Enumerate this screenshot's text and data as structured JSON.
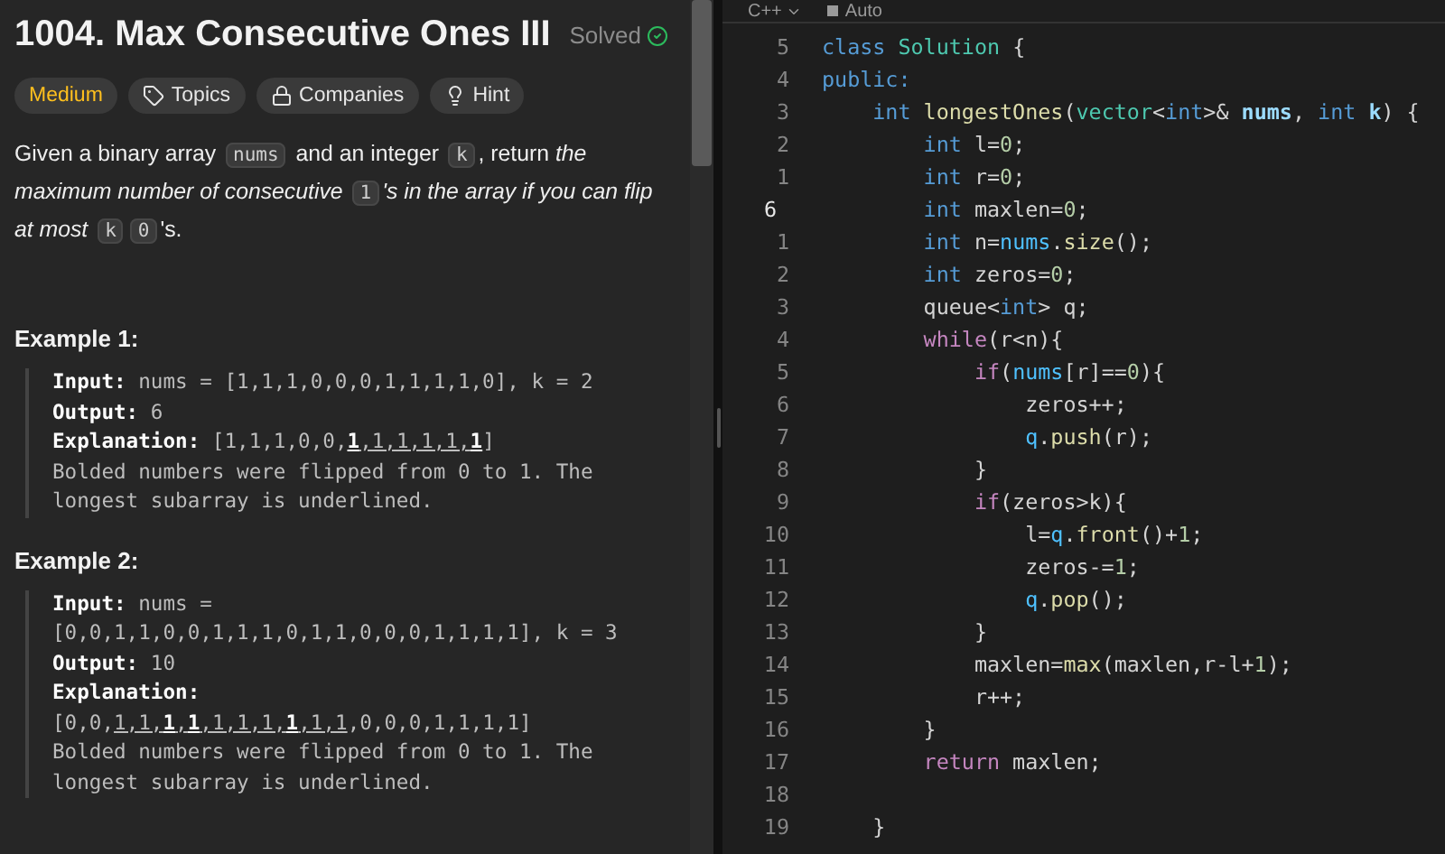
{
  "problem": {
    "title": "1004. Max Consecutive Ones III",
    "status": "Solved",
    "tags": [
      {
        "kind": "difficulty",
        "label": "Medium"
      },
      {
        "kind": "topics",
        "label": "Topics"
      },
      {
        "kind": "companies",
        "label": "Companies"
      },
      {
        "kind": "hint",
        "label": "Hint"
      }
    ],
    "description": [
      {
        "kind": "text",
        "text": "Given a binary array "
      },
      {
        "kind": "code",
        "text": "nums"
      },
      {
        "kind": "text",
        "text": " and an integer "
      },
      {
        "kind": "code",
        "text": "k"
      },
      {
        "kind": "text",
        "text": ", return "
      },
      {
        "kind": "italic",
        "text": "the maximum number of consecutive "
      },
      {
        "kind": "code",
        "text": "1"
      },
      {
        "kind": "italic",
        "text": "'s in the array if you can flip at most "
      },
      {
        "kind": "code",
        "text": "k"
      },
      {
        "kind": "code",
        "text": "0"
      },
      {
        "kind": "text",
        "text": "'s."
      }
    ],
    "examples": [
      {
        "title": "Example 1:",
        "lines": [
          [
            {
              "kind": "label",
              "text": "Input:"
            },
            {
              "kind": "plain",
              "text": " nums = [1,1,1,0,0,0,1,1,1,1,0], k = 2"
            }
          ],
          [
            {
              "kind": "label",
              "text": "Output:"
            },
            {
              "kind": "plain",
              "text": " 6"
            }
          ],
          [
            {
              "kind": "label",
              "text": "Explanation:"
            },
            {
              "kind": "plain",
              "text": " [1,1,1,0,0,"
            },
            {
              "kind": "bold_underline",
              "text": "1"
            },
            {
              "kind": "underline",
              "text": ",1,1,1,1,"
            },
            {
              "kind": "bold_underline",
              "text": "1"
            },
            {
              "kind": "plain",
              "text": "]"
            }
          ],
          [
            {
              "kind": "plain",
              "text": "Bolded numbers were flipped from 0 to 1. The longest subarray is underlined."
            }
          ]
        ]
      },
      {
        "title": "Example 2:",
        "lines": [
          [
            {
              "kind": "label",
              "text": "Input:"
            },
            {
              "kind": "plain",
              "text": " nums = [0,0,1,1,0,0,1,1,1,0,1,1,0,0,0,1,1,1,1], k = 3"
            }
          ],
          [
            {
              "kind": "label",
              "text": "Output:"
            },
            {
              "kind": "plain",
              "text": " 10"
            }
          ],
          [
            {
              "kind": "label",
              "text": "Explanation:"
            },
            {
              "kind": "plain",
              "text": " [0,0,"
            },
            {
              "kind": "underline",
              "text": "1,1,"
            },
            {
              "kind": "bold_underline",
              "text": "1"
            },
            {
              "kind": "underline",
              "text": ","
            },
            {
              "kind": "bold_underline",
              "text": "1"
            },
            {
              "kind": "underline",
              "text": ",1,1,1,"
            },
            {
              "kind": "bold_underline",
              "text": "1"
            },
            {
              "kind": "underline",
              "text": ",1,1"
            },
            {
              "kind": "plain",
              "text": ",0,0,0,1,1,1,1]"
            }
          ],
          [
            {
              "kind": "plain",
              "text": "Bolded numbers were flipped from 0 to 1. The longest subarray is underlined."
            }
          ]
        ]
      }
    ]
  },
  "editor": {
    "language": "C++",
    "mode": "Auto",
    "lines": [
      {
        "number": "5",
        "current": false,
        "tokens": [
          {
            "kind": "kw",
            "text": "class"
          },
          {
            "kind": "type",
            "text": " Solution"
          },
          {
            "kind": "plain",
            "text": " {"
          }
        ]
      },
      {
        "number": "4",
        "current": false,
        "tokens": [
          {
            "kind": "kw",
            "text": "public:"
          }
        ]
      },
      {
        "number": "3",
        "current": false,
        "tokens": [
          {
            "kind": "kw",
            "text": "    int"
          },
          {
            "kind": "fn",
            "text": " longestOnes"
          },
          {
            "kind": "plain",
            "text": "("
          },
          {
            "kind": "type",
            "text": "vector"
          },
          {
            "kind": "plain",
            "text": "<"
          },
          {
            "kind": "kw",
            "text": "int"
          },
          {
            "kind": "plain",
            "text": ">& "
          },
          {
            "kind": "param",
            "text": "nums"
          },
          {
            "kind": "plain",
            "text": ", "
          },
          {
            "kind": "kw",
            "text": "int"
          },
          {
            "kind": "param",
            "text": " k"
          },
          {
            "kind": "plain",
            "text": ") {"
          }
        ]
      },
      {
        "number": "2",
        "current": false,
        "tokens": [
          {
            "kind": "kw",
            "text": "        int"
          },
          {
            "kind": "plain",
            "text": " l="
          },
          {
            "kind": "num",
            "text": "0"
          },
          {
            "kind": "plain",
            "text": ";"
          }
        ]
      },
      {
        "number": "1",
        "current": false,
        "tokens": [
          {
            "kind": "kw",
            "text": "        int"
          },
          {
            "kind": "plain",
            "text": " r="
          },
          {
            "kind": "num",
            "text": "0"
          },
          {
            "kind": "plain",
            "text": ";"
          }
        ]
      },
      {
        "number": "6",
        "current": true,
        "tokens": [
          {
            "kind": "kw",
            "text": "        int"
          },
          {
            "kind": "plain",
            "text": " maxlen="
          },
          {
            "kind": "num",
            "text": "0"
          },
          {
            "kind": "plain",
            "text": ";"
          }
        ]
      },
      {
        "number": "1",
        "current": false,
        "tokens": [
          {
            "kind": "kw",
            "text": "        int"
          },
          {
            "kind": "plain",
            "text": " n="
          },
          {
            "kind": "var",
            "text": "nums"
          },
          {
            "kind": "plain",
            "text": "."
          },
          {
            "kind": "fn",
            "text": "size"
          },
          {
            "kind": "plain",
            "text": "();"
          }
        ]
      },
      {
        "number": "2",
        "current": false,
        "tokens": [
          {
            "kind": "kw",
            "text": "        int"
          },
          {
            "kind": "plain",
            "text": " zeros="
          },
          {
            "kind": "num",
            "text": "0"
          },
          {
            "kind": "plain",
            "text": ";"
          }
        ]
      },
      {
        "number": "3",
        "current": false,
        "tokens": [
          {
            "kind": "plain",
            "text": "        queue<"
          },
          {
            "kind": "kw",
            "text": "int"
          },
          {
            "kind": "plain",
            "text": "> q;"
          }
        ]
      },
      {
        "number": "4",
        "current": false,
        "tokens": [
          {
            "kind": "ctl",
            "text": "        while"
          },
          {
            "kind": "plain",
            "text": "(r<n){"
          }
        ]
      },
      {
        "number": "5",
        "current": false,
        "tokens": [
          {
            "kind": "ctl",
            "text": "            if"
          },
          {
            "kind": "plain",
            "text": "("
          },
          {
            "kind": "var",
            "text": "nums"
          },
          {
            "kind": "plain",
            "text": "[r]=="
          },
          {
            "kind": "num",
            "text": "0"
          },
          {
            "kind": "plain",
            "text": "){"
          }
        ]
      },
      {
        "number": "6",
        "current": false,
        "tokens": [
          {
            "kind": "plain",
            "text": "                zeros++;"
          }
        ]
      },
      {
        "number": "7",
        "current": false,
        "tokens": [
          {
            "kind": "var",
            "text": "                q"
          },
          {
            "kind": "plain",
            "text": "."
          },
          {
            "kind": "fn",
            "text": "push"
          },
          {
            "kind": "plain",
            "text": "(r);"
          }
        ]
      },
      {
        "number": "8",
        "current": false,
        "tokens": [
          {
            "kind": "plain",
            "text": "            }"
          }
        ]
      },
      {
        "number": "9",
        "current": false,
        "tokens": [
          {
            "kind": "ctl",
            "text": "            if"
          },
          {
            "kind": "plain",
            "text": "(zeros>k){"
          }
        ]
      },
      {
        "number": "10",
        "current": false,
        "tokens": [
          {
            "kind": "plain",
            "text": "                l="
          },
          {
            "kind": "var",
            "text": "q"
          },
          {
            "kind": "plain",
            "text": "."
          },
          {
            "kind": "fn",
            "text": "front"
          },
          {
            "kind": "plain",
            "text": "()+"
          },
          {
            "kind": "num",
            "text": "1"
          },
          {
            "kind": "plain",
            "text": ";"
          }
        ]
      },
      {
        "number": "11",
        "current": false,
        "tokens": [
          {
            "kind": "plain",
            "text": "                zeros-="
          },
          {
            "kind": "num",
            "text": "1"
          },
          {
            "kind": "plain",
            "text": ";"
          }
        ]
      },
      {
        "number": "12",
        "current": false,
        "tokens": [
          {
            "kind": "var",
            "text": "                q"
          },
          {
            "kind": "plain",
            "text": "."
          },
          {
            "kind": "fn",
            "text": "pop"
          },
          {
            "kind": "plain",
            "text": "();"
          }
        ]
      },
      {
        "number": "13",
        "current": false,
        "tokens": [
          {
            "kind": "plain",
            "text": "            }"
          }
        ]
      },
      {
        "number": "14",
        "current": false,
        "tokens": [
          {
            "kind": "plain",
            "text": "            maxlen="
          },
          {
            "kind": "fn",
            "text": "max"
          },
          {
            "kind": "plain",
            "text": "(maxlen,r-l+"
          },
          {
            "kind": "num",
            "text": "1"
          },
          {
            "kind": "plain",
            "text": ");"
          }
        ]
      },
      {
        "number": "15",
        "current": false,
        "tokens": [
          {
            "kind": "plain",
            "text": "            r++;"
          }
        ]
      },
      {
        "number": "16",
        "current": false,
        "tokens": [
          {
            "kind": "plain",
            "text": "        }"
          }
        ]
      },
      {
        "number": "17",
        "current": false,
        "tokens": [
          {
            "kind": "ctl",
            "text": "        return"
          },
          {
            "kind": "plain",
            "text": " maxlen;"
          }
        ]
      },
      {
        "number": "18",
        "current": false
      },
      {
        "number": "19",
        "current": false,
        "tokens": [
          {
            "kind": "plain",
            "text": "    }"
          }
        ]
      }
    ]
  }
}
